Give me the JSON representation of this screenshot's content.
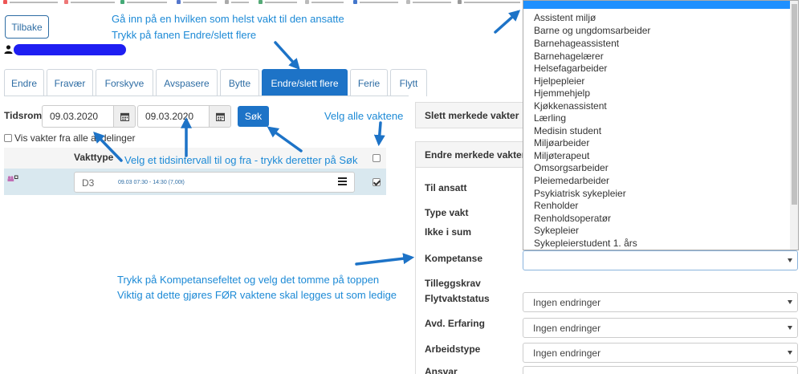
{
  "header": {
    "back_label": "Tilbake"
  },
  "tabs": [
    {
      "label": "Endre",
      "active": false
    },
    {
      "label": "Fravær",
      "active": false
    },
    {
      "label": "Forskyve",
      "active": false
    },
    {
      "label": "Avspasere",
      "active": false
    },
    {
      "label": "Bytte",
      "active": false
    },
    {
      "label": "Endre/slett flere",
      "active": true
    },
    {
      "label": "Ferie",
      "active": false
    },
    {
      "label": "Flytt",
      "active": false
    }
  ],
  "filters": {
    "period_label": "Tidsrom",
    "from_date": "09.03.2020",
    "to_date": "09.03.2020",
    "search_label": "Søk",
    "show_all_departments_label": "Vis vakter fra alle avdelinger",
    "show_all_departments_checked": false
  },
  "table": {
    "column_shift_type": "Vakttype",
    "select_all_checked": false,
    "rows": [
      {
        "code": "D3",
        "time": "09.03 07:30 - 14:30 (7,00t)",
        "checked": true
      }
    ]
  },
  "panels": {
    "delete_title": "Slett merkede vakter",
    "edit_title": "Endre merkede vakter"
  },
  "form": {
    "labels": {
      "to_employee": "Til ansatt",
      "shift_type": "Type vakt",
      "not_in_sum": "Ikke i sum",
      "competence": "Kompetanse",
      "supplement": "Tilleggskrav",
      "flex_status": "Flytvaktstatus",
      "dept_experience": "Avd. Erfaring",
      "work_type": "Arbeidstype",
      "responsibility": "Ansvar"
    },
    "values": {
      "competence": "",
      "flex_status": "Ingen endringer",
      "dept_experience": "Ingen endringer",
      "work_type": "Ingen endringer"
    }
  },
  "competence_dropdown": {
    "options": [
      "Assistent miljø",
      "Barne og ungdomsarbeider",
      "Barnehageassistent",
      "Barnehagelærer",
      "Helsefagarbeider",
      "Hjelpepleier",
      "Hjemmehjelp",
      "Kjøkkenassistent",
      "Lærling",
      "Medisin student",
      "Miljøarbeider",
      "Miljøterapeut",
      "Omsorgsarbeider",
      "Pleiemedarbeider",
      "Psykiatrisk sykepleier",
      "Renholder",
      "Renholdsoperatør",
      "Sykepleier",
      "Sykepleierstudent 1. års"
    ]
  },
  "annotations": {
    "tab_note_1": "Gå inn på en hvilken som helst vakt til den ansatte",
    "tab_note_2": "Trykk på fanen Endre/slett flere",
    "select_all_note": "Velg alle vaktene",
    "interval_note": "Velg et tidsintervall til og fra - trykk deretter på Søk",
    "competence_note_1": "Trykk på Kompetansefeltet og velg det tomme på toppen",
    "competence_note_2": "Viktig at dette gjøres FØR vaktene skal legges ut som ledige"
  },
  "colors": {
    "primary": "#1d73c7",
    "annotation": "#1d8ad6",
    "row_highlight": "#d9e8ef",
    "dropdown_selected": "#1e90ff"
  }
}
